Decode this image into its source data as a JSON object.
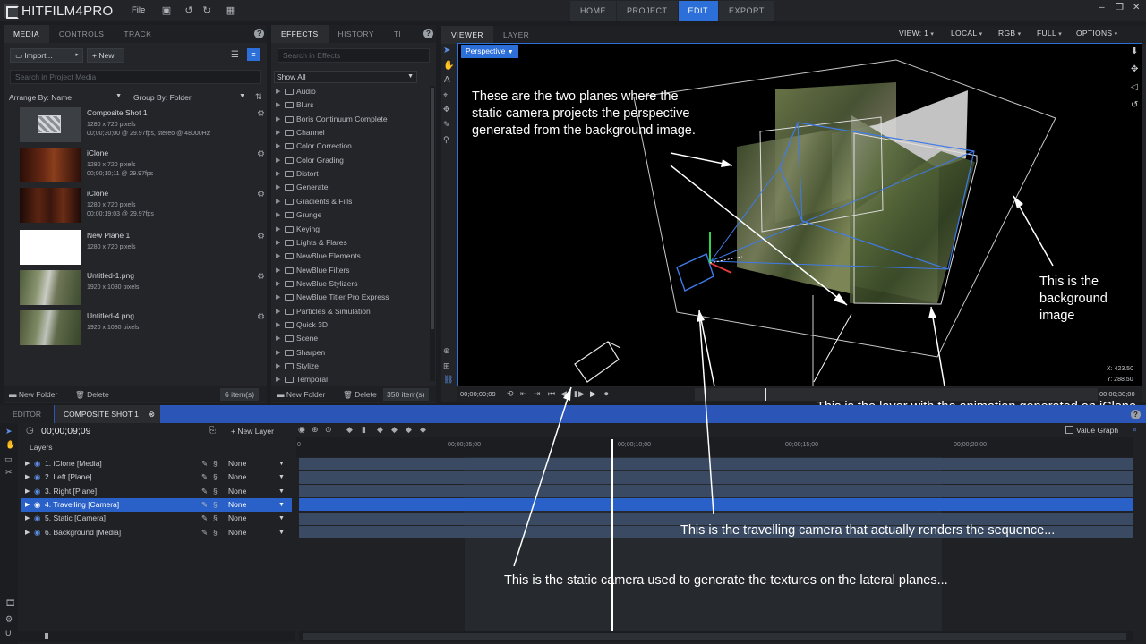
{
  "app": {
    "logo_text": "HITFILM4PRO",
    "menu_file": "File",
    "main_tabs": [
      "HOME",
      "PROJECT",
      "EDIT",
      "EXPORT"
    ],
    "active_tab": "EDIT"
  },
  "media_panel": {
    "tabs": [
      "MEDIA",
      "CONTROLS",
      "TRACK"
    ],
    "import_label": "Import...",
    "new_label": "New",
    "search_placeholder": "Search in Project Media",
    "arrange_label": "Arrange By: Name",
    "group_label": "Group By: Folder",
    "items": [
      {
        "title": "Composite Shot 1",
        "line1": "1280 x 720 pixels",
        "line2": "00;00;30;00 @ 29.97fps, stereo @ 48000Hz"
      },
      {
        "title": "iClone",
        "line1": "1280 x 720 pixels",
        "line2": "00;00;10;11 @ 29.97fps"
      },
      {
        "title": "iClone",
        "line1": "1280 x 720 pixels",
        "line2": "00;00;19;03 @ 29.97fps"
      },
      {
        "title": "New Plane 1",
        "line1": "1280 x 720 pixels",
        "line2": ""
      },
      {
        "title": "Untitled-1.png",
        "line1": "1920 x 1080 pixels",
        "line2": ""
      },
      {
        "title": "Untitled-4.png",
        "line1": "1920 x 1080 pixels",
        "line2": ""
      }
    ],
    "new_folder": "New Folder",
    "delete": "Delete",
    "count": "6 item(s)"
  },
  "effects_panel": {
    "tabs": [
      "EFFECTS",
      "HISTORY",
      "TI"
    ],
    "search_placeholder": "Search in Effects",
    "filter": "Show All",
    "folders": [
      "Audio",
      "Blurs",
      "Boris Continuum Complete",
      "Channel",
      "Color Correction",
      "Color Grading",
      "Distort",
      "Generate",
      "Gradients & Fills",
      "Grunge",
      "Keying",
      "Lights & Flares",
      "NewBlue Elements",
      "NewBlue Filters",
      "NewBlue Stylizers",
      "NewBlue Titler Pro Express",
      "Particles & Simulation",
      "Quick 3D",
      "Scene",
      "Sharpen",
      "Stylize",
      "Temporal"
    ],
    "new_folder": "New Folder",
    "delete": "Delete",
    "count": "350 item(s)"
  },
  "viewer": {
    "tabs": [
      "VIEWER",
      "LAYER"
    ],
    "perspective": "Perspective",
    "options": [
      "VIEW: 1",
      "LOCAL",
      "RGB",
      "FULL",
      "OPTIONS"
    ],
    "coord_x": "X:   423.50",
    "coord_y": "Y:   288.50",
    "time_left": "00;00;09;09",
    "time_right": "00;00;30;00"
  },
  "annotations": {
    "planes": "These are the two planes where the static camera projects the perspective generated from the background image.",
    "background": "This is the background image",
    "layer": "This is the layer with the animation generated on iClone with a transparent background",
    "travelling": "This is the travelling camera that actually renders the sequence...",
    "static": "This is the static camera used to generate the textures on the lateral planes..."
  },
  "editor": {
    "tabs": [
      "EDITOR",
      "COMPOSITE SHOT 1"
    ],
    "timecode": "00;00;09;09",
    "new_layer": "New Layer",
    "value_graph": "Value Graph",
    "layers_header": "Layers",
    "layers": [
      {
        "label": "1. iClone [Media]",
        "blend": "None"
      },
      {
        "label": "2. Left [Plane]",
        "blend": "None"
      },
      {
        "label": "3. Right [Plane]",
        "blend": "None"
      },
      {
        "label": "4. Travelling [Camera]",
        "blend": "None"
      },
      {
        "label": "5. Static [Camera]",
        "blend": "None"
      },
      {
        "label": "6. Background [Media]",
        "blend": "None"
      }
    ],
    "ruler": [
      "0",
      "00;00;05;00",
      "00;00;10;00",
      "00;00;15;00",
      "00;00;20;00"
    ]
  },
  "colors": {
    "accent": "#2c6fd8",
    "selected_row": "#2a61c8",
    "track": "#3a4a62"
  }
}
